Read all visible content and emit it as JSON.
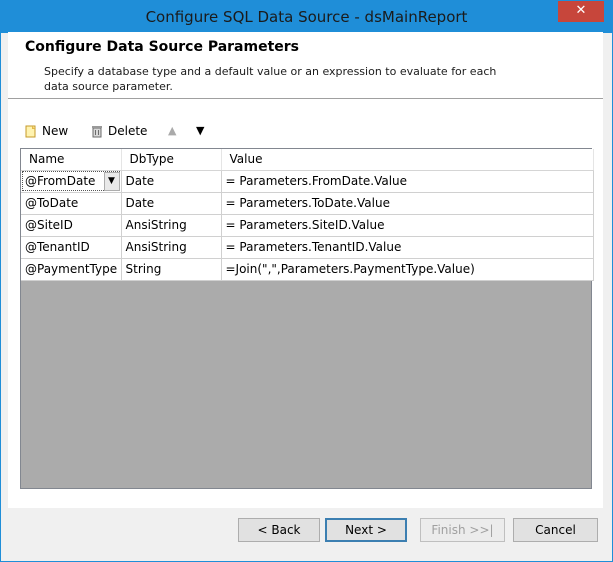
{
  "window": {
    "title": "Configure SQL Data Source - dsMainReport",
    "close_glyph": "✕"
  },
  "header": {
    "title": "Configure Data Source Parameters",
    "description": "Specify a database type and a default value or an expression to evaluate for each data source parameter."
  },
  "toolbar": {
    "new_label": "New",
    "delete_label": "Delete",
    "move_up_icon": "arrow-up-icon",
    "move_down_icon": "arrow-down-icon",
    "up_glyph": "▲",
    "down_glyph": "▼"
  },
  "grid": {
    "columns": [
      "Name",
      "DbType",
      "Value"
    ],
    "dropdown_glyph": "▼",
    "rows": [
      {
        "name": "@FromDate",
        "dbtype": "Date",
        "value": "= Parameters.FromDate.Value"
      },
      {
        "name": "@ToDate",
        "dbtype": "Date",
        "value": "= Parameters.ToDate.Value"
      },
      {
        "name": "@SiteID",
        "dbtype": "AnsiString",
        "value": "= Parameters.SiteID.Value"
      },
      {
        "name": "@TenantID",
        "dbtype": "AnsiString",
        "value": "= Parameters.TenantID.Value"
      },
      {
        "name": "@PaymentType",
        "dbtype": "String",
        "value": "=Join(\",\",Parameters.PaymentType.Value)"
      }
    ]
  },
  "footer": {
    "back_label": "< Back",
    "next_label": "Next >",
    "finish_label": "Finish >>|",
    "cancel_label": "Cancel"
  },
  "colors": {
    "titlebar": "#1f8ed8",
    "close_button": "#c7463b",
    "grid_empty": "#ababab"
  }
}
